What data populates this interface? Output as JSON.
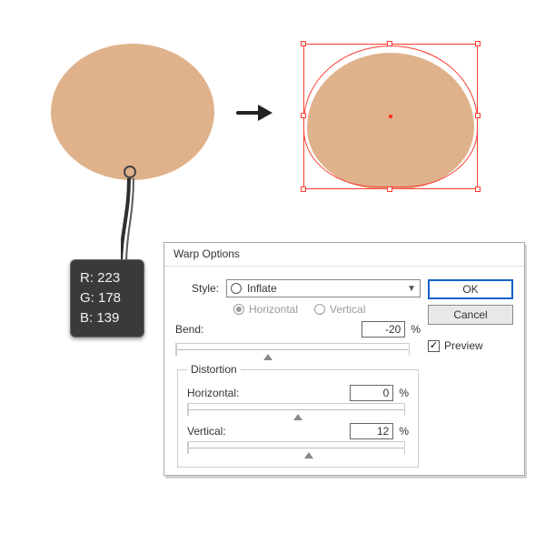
{
  "shape": {
    "fill": "#dfb28b",
    "rgb": {
      "r_label": "R: 223",
      "g_label": "G: 178",
      "b_label": "B: 139"
    }
  },
  "dialog": {
    "title": "Warp Options",
    "style_label": "Style:",
    "style_value": "Inflate",
    "orientation": {
      "horizontal": "Horizontal",
      "vertical": "Vertical"
    },
    "bend": {
      "label": "Bend:",
      "value": "-20",
      "pct": "%"
    },
    "distortion": {
      "legend": "Distortion",
      "horizontal": {
        "label": "Horizontal:",
        "value": "0",
        "pct": "%"
      },
      "vertical": {
        "label": "Vertical:",
        "value": "12",
        "pct": "%"
      }
    },
    "buttons": {
      "ok": "OK",
      "cancel": "Cancel"
    },
    "preview": {
      "label": "Preview",
      "checked": "✓"
    }
  }
}
